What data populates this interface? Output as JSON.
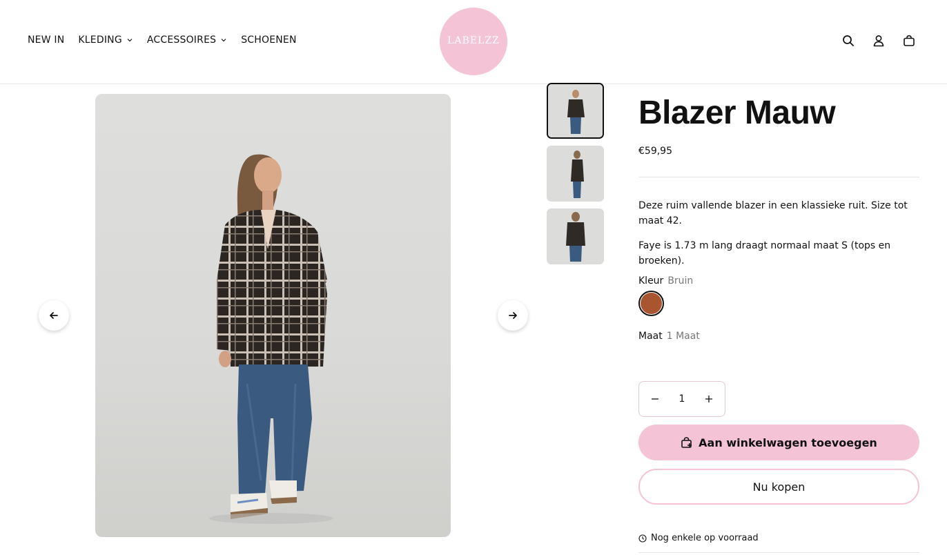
{
  "nav": {
    "items": [
      {
        "label": "NEW IN",
        "has_dropdown": false,
        "icon": ""
      },
      {
        "label": "KLEDING",
        "has_dropdown": true,
        "icon": "chevron-down-icon"
      },
      {
        "label": "ACCESSOIRES",
        "has_dropdown": true,
        "icon": "chevron-down-icon"
      },
      {
        "label": "SCHOENEN",
        "has_dropdown": false,
        "icon": ""
      }
    ]
  },
  "logo": {
    "text": "LABELZZ",
    "subtext": "",
    "color": "#f4c3d6"
  },
  "header_icons": [
    "search-icon",
    "account-icon",
    "cart-icon"
  ],
  "gallery": {
    "thumbnails": [
      {
        "active": true,
        "pose": "front"
      },
      {
        "active": false,
        "pose": "side"
      },
      {
        "active": false,
        "pose": "back"
      }
    ],
    "prev_icon": "arrow-left-icon",
    "next_icon": "arrow-right-icon"
  },
  "product": {
    "title": "Blazer Mauw",
    "price": "€59,95",
    "description": "Deze ruim vallende blazer in een klassieke ruit. Size tot maat 42.",
    "model_info": "Faye is 1.73 m lang draagt normaal maat S (tops en broeken).",
    "color_label": "Kleur",
    "color_value": "Bruin",
    "swatch_color": "#a85530",
    "size_label": "Maat",
    "size_value": "1 Maat",
    "quantity": "1",
    "add_to_cart": "Aan winkelwagen toevoegen",
    "buy_now": "Nu kopen",
    "stock_status": "Nog enkele op voorraad"
  },
  "colors": {
    "accent_pink": "#f4c3d6",
    "text": "#111111",
    "muted": "#777777"
  }
}
